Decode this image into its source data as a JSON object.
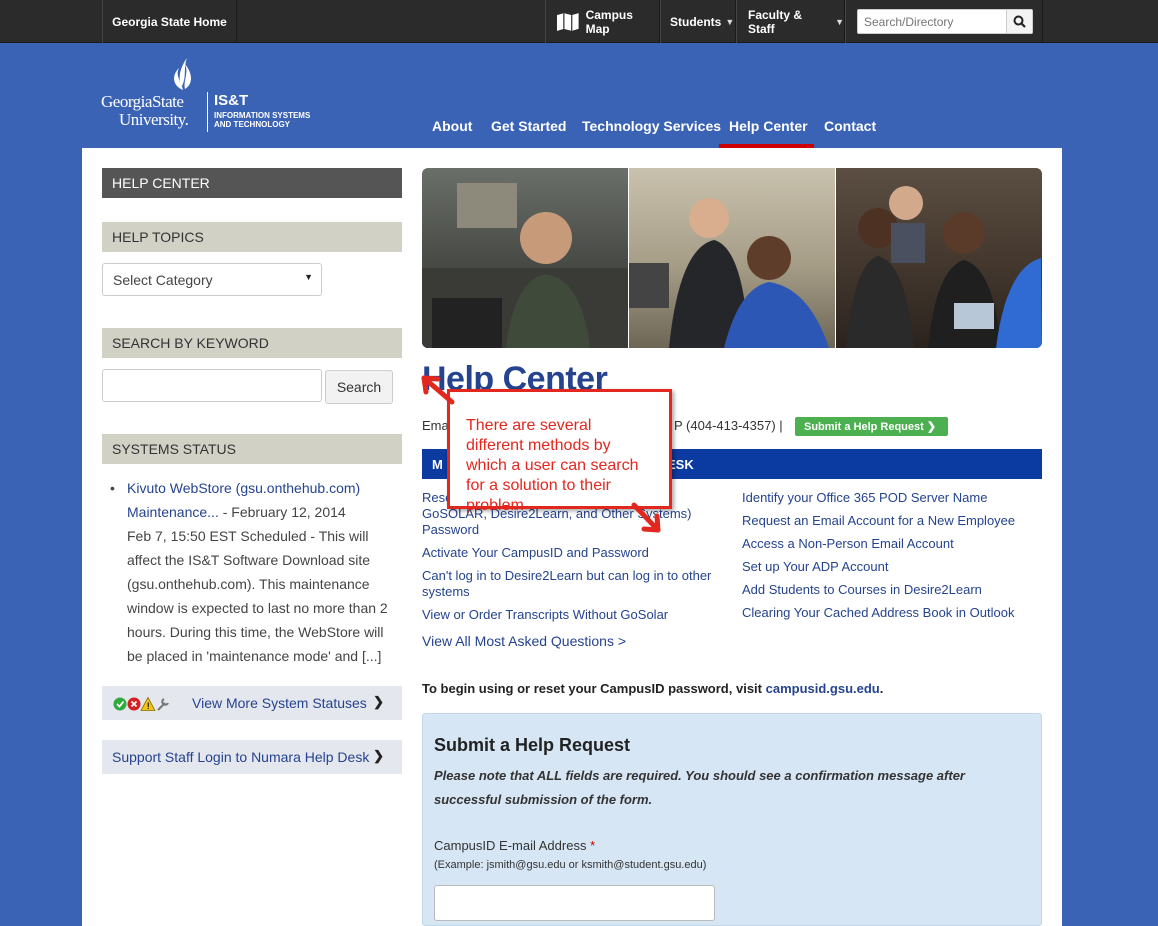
{
  "topbar": {
    "home": "Georgia State Home",
    "campus_map": "Campus Map",
    "students": "Students",
    "faculty": "Faculty & Staff",
    "search_placeholder": "Search/Directory"
  },
  "logo": {
    "line1": "GeorgiaState",
    "line2": "University.",
    "unit": "IS&T",
    "unit_line1": "INFORMATION SYSTEMS",
    "unit_line2": "AND TECHNOLOGY"
  },
  "nav": [
    "About",
    "Get Started",
    "Technology Services",
    "Help Center",
    "Contact"
  ],
  "nav_active": "Help Center",
  "sidebar": {
    "help_center": "HELP CENTER",
    "help_topics": "HELP TOPICS",
    "select_category": "Select Category",
    "search_by_keyword": "SEARCH BY KEYWORD",
    "search_button": "Search",
    "systems_status": "SYSTEMS STATUS",
    "status_item": {
      "link": "Kivuto WebStore (gsu.onthehub.com) Maintenance...",
      "date": " - February 12, 2014",
      "body": "Feb 7, 15:50 EST Scheduled - This will affect the IS&T Software Download site (gsu.onthehub.com). This maintenance window is expected to last no more than 2 hours. During this time, the WebStore will be placed in 'maintenance mode' and [...]"
    },
    "view_more": "View More System Statuses",
    "support_login": "Support Staff Login to Numara Help Desk"
  },
  "main": {
    "title": "Help Center",
    "contact_left": "Ema",
    "contact_right": "P (404-413-4357) |",
    "submit_help": "Submit a Help Request",
    "bar_left": "M",
    "bar_right": "ESK",
    "links_left": [
      "Rese",
      "GoSOLAR, Desire2Learn, and Other Systems)",
      "Password",
      "Activate Your CampusID and Password",
      "Can't log in to Desire2Learn but can log in to other systems",
      "View or Order Transcripts Without GoSolar"
    ],
    "links_right": [
      "Identify your Office 365 POD Server Name",
      "Request an Email Account for a New Employee",
      "Access a Non-Person Email Account",
      "Set up Your ADP Account",
      "Add Students to Courses in Desire2Learn",
      "Clearing Your Cached Address Book in Outlook"
    ],
    "view_all": "View All Most Asked Questions >",
    "campusid_text": "To begin using or reset your CampusID password, visit ",
    "campusid_link": "campusid.gsu.edu",
    "campusid_end": "."
  },
  "form": {
    "heading": "Submit a Help Request",
    "note": "Please note that ALL fields are required. You should see a confirmation message after successful submission of the form.",
    "email_label": "CampusID E-mail Address",
    "required_mark": "*",
    "email_example": "(Example: jsmith@gsu.edu or ksmith@student.gsu.edu)"
  },
  "callout": {
    "text": "There are several different methods by which a user can search for a solution to their problem"
  },
  "colors": {
    "page_blue": "#3a63b6",
    "topbar": "#2b2b2b",
    "link": "#25438f",
    "dark_blue_bar": "#0b3aa0",
    "green_button": "#4caf50",
    "red": "#e2271f"
  }
}
